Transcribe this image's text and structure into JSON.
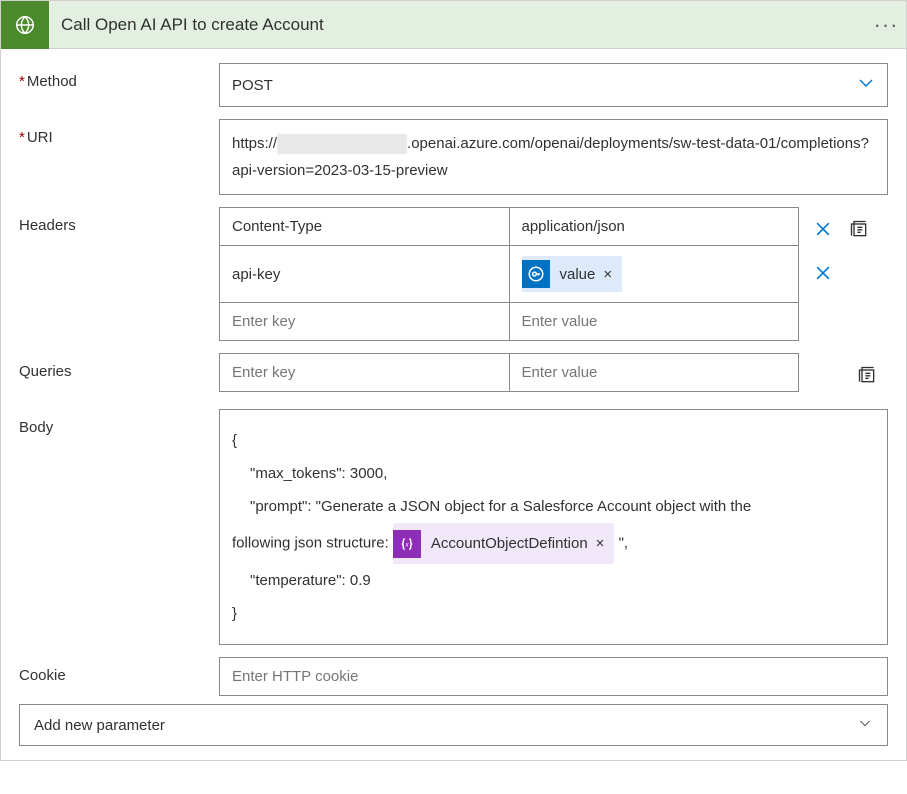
{
  "header": {
    "title": "Call Open AI API to create Account"
  },
  "fields": {
    "method_label": "Method",
    "method_value": "POST",
    "uri_label": "URI",
    "uri_prefix": "https://",
    "uri_suffix": ".openai.azure.com/openai/deployments/sw-test-data-01/completions?api-version=2023-03-15-preview",
    "headers_label": "Headers",
    "queries_label": "Queries",
    "body_label": "Body",
    "cookie_label": "Cookie",
    "cookie_placeholder": "Enter HTTP cookie",
    "key_placeholder": "Enter key",
    "value_placeholder": "Enter value"
  },
  "headers": {
    "rows": [
      {
        "key": "Content-Type",
        "value_text": "application/json",
        "value_token": null
      },
      {
        "key": "api-key",
        "value_text": "",
        "value_token": "value"
      }
    ]
  },
  "body": {
    "open": "{",
    "line1": "\"max_tokens\": 3000,",
    "line2a": "\"prompt\": \"Generate a JSON object for a Salesforce Account object with the",
    "line2b_prefix": "following json structure: ",
    "expr_token": "AccountObjectDefintion",
    "line2b_suffix": " \",",
    "line3": "\"temperature\": 0.9",
    "close": "}"
  },
  "add_param_label": "Add new parameter"
}
